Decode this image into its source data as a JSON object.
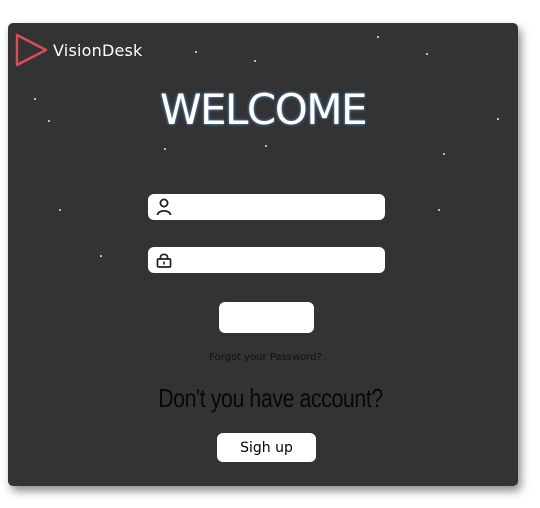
{
  "brand": {
    "name": "VisionDesk",
    "accent_color": "#e04a5e"
  },
  "login": {
    "heading": "WELCOME",
    "username": {
      "value": "",
      "icon": "user-icon"
    },
    "password": {
      "value": "",
      "icon": "lock-icon"
    },
    "login_button_label": "",
    "forgot_password": "Forgot your Password?",
    "no_account_prompt": "Don't you have account?",
    "signup_button_label": "Sigh up"
  },
  "colors": {
    "panel_background": "#333333",
    "field_background": "#ffffff"
  }
}
